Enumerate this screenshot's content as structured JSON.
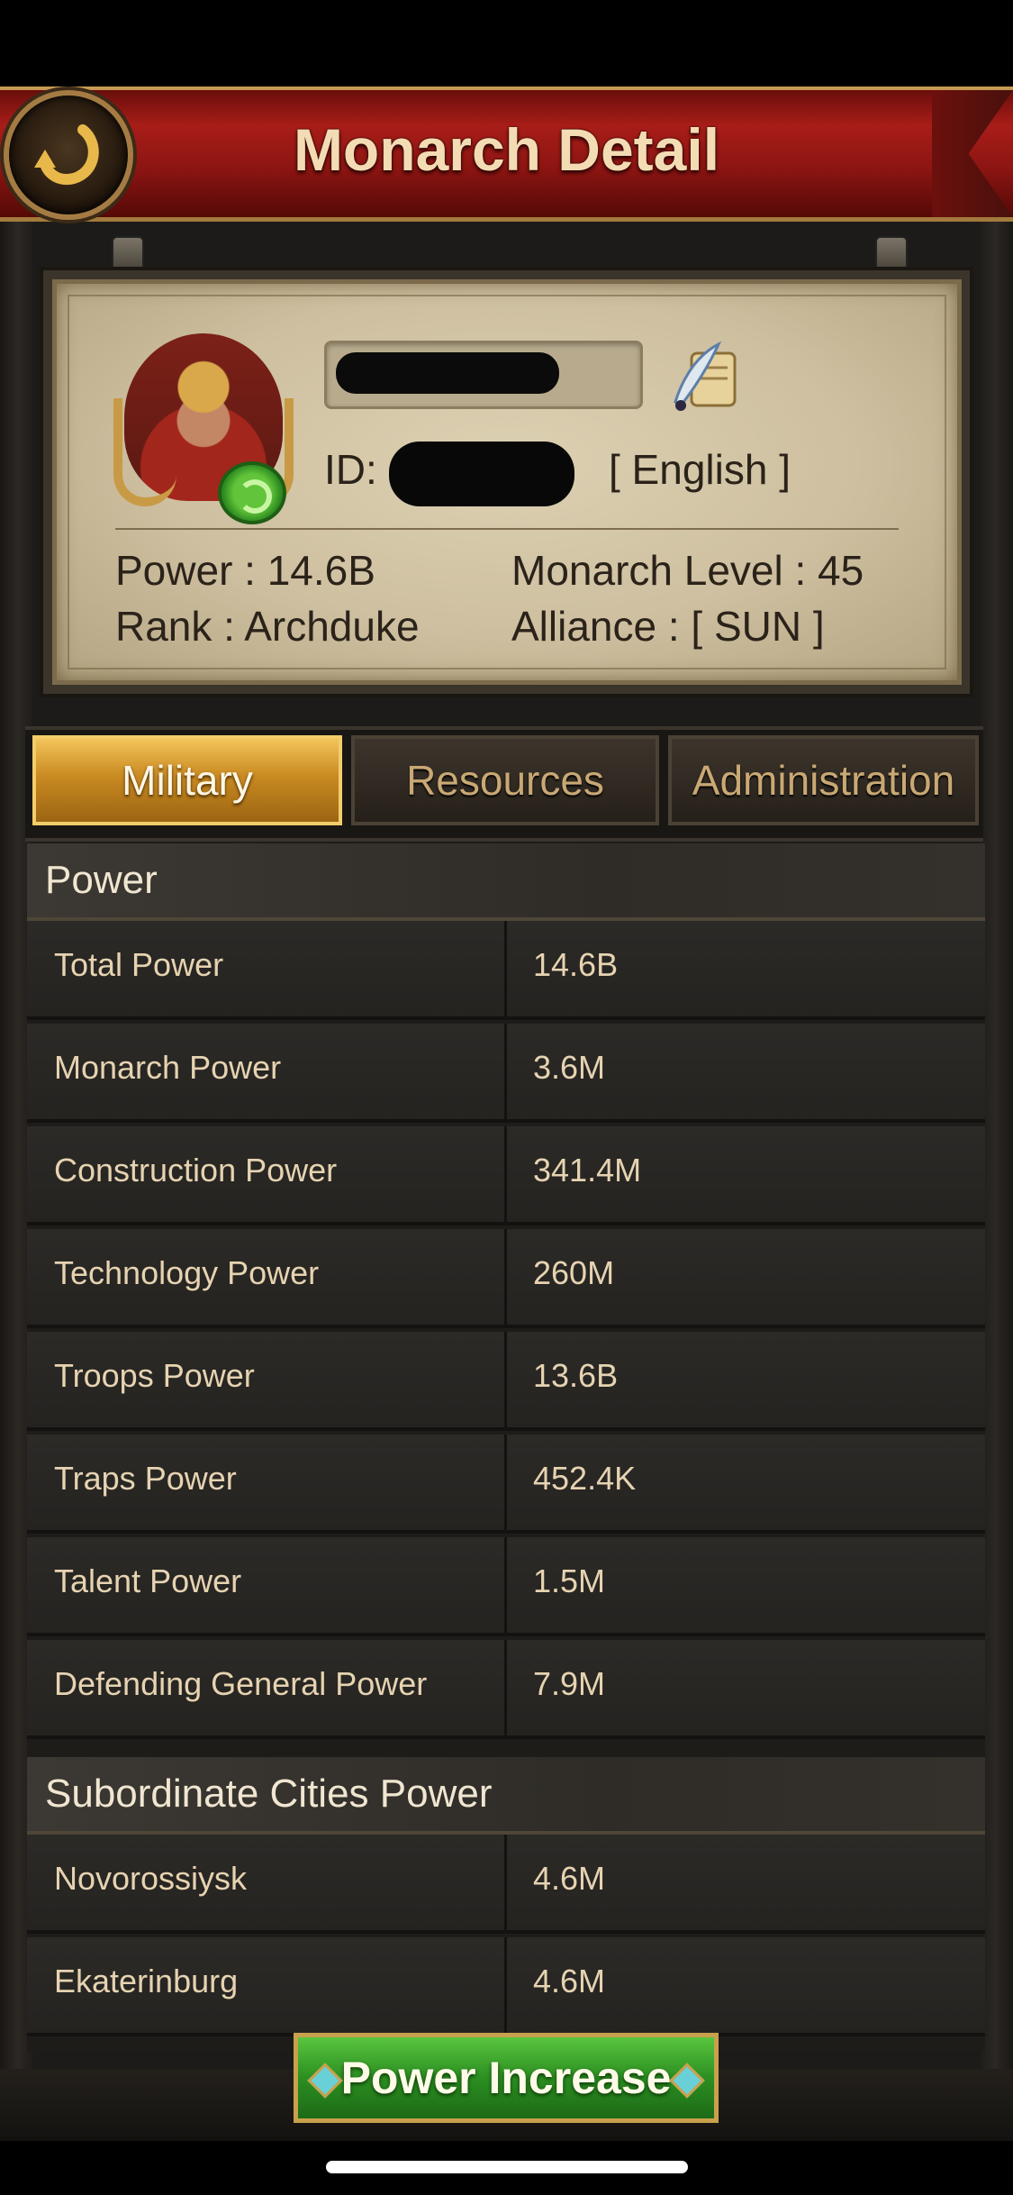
{
  "header": {
    "title": "Monarch Detail"
  },
  "profile": {
    "id_label": "ID:",
    "language": "[ English ]",
    "power": "Power : 14.6B",
    "rank": "Rank : Archduke",
    "monarch_level": "Monarch Level : 45",
    "alliance": "Alliance :  [ SUN ]"
  },
  "tabs": [
    {
      "label": "Military",
      "active": true
    },
    {
      "label": "Resources",
      "active": false
    },
    {
      "label": "Administration",
      "active": false
    }
  ],
  "sections": [
    {
      "title": "Power",
      "rows": [
        {
          "label": "Total Power",
          "value": "14.6B"
        },
        {
          "label": "Monarch Power",
          "value": "3.6M"
        },
        {
          "label": "Construction Power",
          "value": "341.4M"
        },
        {
          "label": "Technology Power",
          "value": "260M"
        },
        {
          "label": "Troops Power",
          "value": "13.6B"
        },
        {
          "label": "Traps Power",
          "value": "452.4K"
        },
        {
          "label": "Talent Power",
          "value": "1.5M"
        },
        {
          "label": "Defending General Power",
          "value": "7.9M"
        }
      ]
    },
    {
      "title": "Subordinate Cities Power",
      "rows": [
        {
          "label": "Novorossiysk",
          "value": "4.6M"
        },
        {
          "label": "Ekaterinburg",
          "value": "4.6M"
        }
      ]
    }
  ],
  "footer": {
    "power_increase_label": "Power Increase"
  },
  "icons": {
    "back": "back-arrow-icon",
    "avatar_badge": "refresh-icon",
    "edit": "scroll-quill-icon"
  },
  "colors": {
    "header_red": "#a81d18",
    "gold_accent": "#c98a22",
    "button_green": "#2b8f21",
    "row_text": "#e6d3b1"
  }
}
